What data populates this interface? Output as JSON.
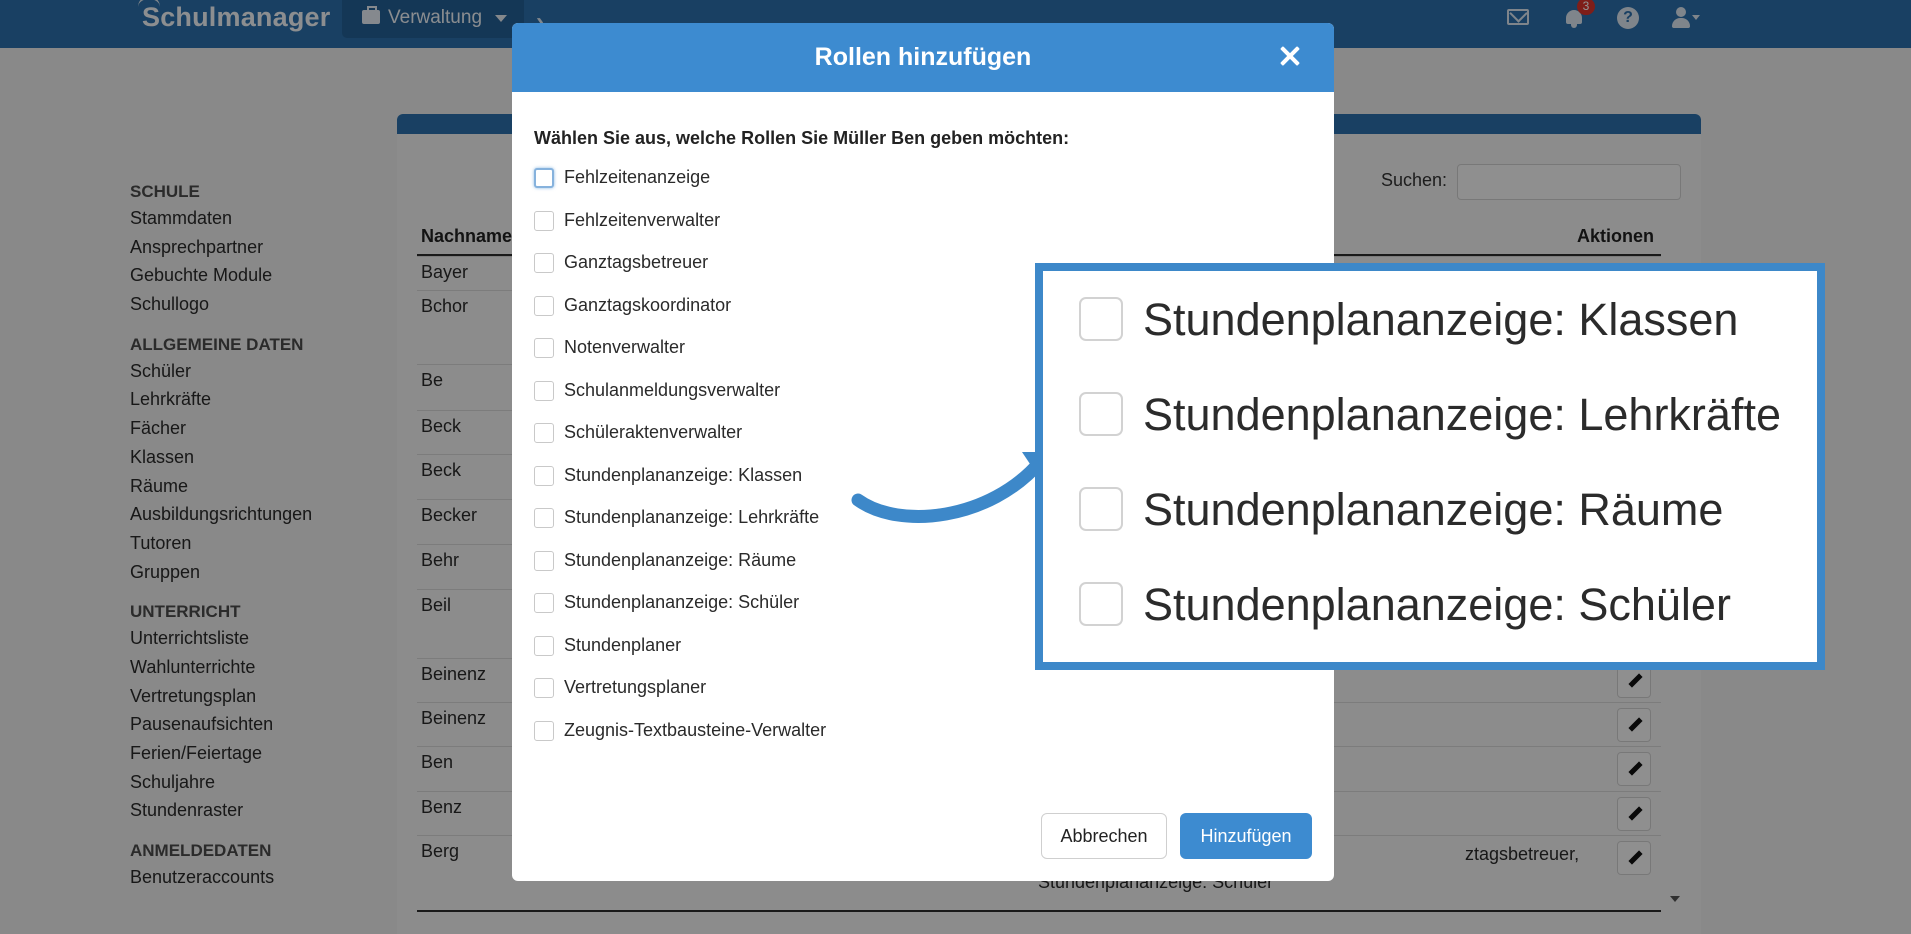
{
  "app": {
    "logo": "Schulmanager",
    "menu_label": "Verwaltung",
    "notification_count": "3",
    "help_glyph": "?"
  },
  "sidebar": {
    "sections": [
      {
        "title": "SCHULE",
        "items": [
          "Stammdaten",
          "Ansprechpartner",
          "Gebuchte Module",
          "Schullogo"
        ]
      },
      {
        "title": "ALLGEMEINE DATEN",
        "items": [
          "Schüler",
          "Lehrkräfte",
          "Fächer",
          "Klassen",
          "Räume",
          "Ausbildungsrichtungen",
          "Tutoren",
          "Gruppen"
        ]
      },
      {
        "title": "UNTERRICHT",
        "items": [
          "Unterrichtsliste",
          "Wahlunterrichte",
          "Vertretungsplan",
          "Pausenaufsichten",
          "Ferien/Feiertage",
          "Schuljahre",
          "Stundenraster"
        ]
      },
      {
        "title": "ANMELDEDATEN",
        "items": [
          "Benutzeraccounts"
        ]
      }
    ]
  },
  "table": {
    "search_label": "Suchen:",
    "header_name": "Nachname",
    "header_actions": "Aktionen",
    "rows": [
      "Bayer",
      "Bchor",
      "Be",
      "Beck",
      "Beck",
      "Becker",
      "Behr",
      "Beil",
      "Beinenz",
      "Beinenz",
      "Ben",
      "Benz",
      "Berg"
    ],
    "berg_roles_line1": "ztagsbetreuer,",
    "berg_roles_line2": "Stundenplananzeige: Schüler"
  },
  "modal": {
    "title": "Rollen hinzufügen",
    "prompt": "Wählen Sie aus, welche Rollen Sie Müller Ben geben möchten:",
    "options": [
      {
        "label": "Fehlzeitenanzeige",
        "checked": false
      },
      {
        "label": "Fehlzeitenverwalter",
        "checked": false
      },
      {
        "label": "Ganztagsbetreuer",
        "checked": false
      },
      {
        "label": "Ganztagskoordinator",
        "checked": false
      },
      {
        "label": "Notenverwalter",
        "checked": false
      },
      {
        "label": "Schulanmeldungsverwalter",
        "checked": false
      },
      {
        "label": "Schüleraktenverwalter",
        "checked": false
      },
      {
        "label": "Stundenplananzeige: Klassen",
        "checked": false
      },
      {
        "label": "Stundenplananzeige: Lehrkräfte",
        "checked": false
      },
      {
        "label": "Stundenplananzeige: Räume",
        "checked": false
      },
      {
        "label": "Stundenplananzeige: Schüler",
        "checked": false
      },
      {
        "label": "Stundenplaner",
        "checked": false
      },
      {
        "label": "Vertretungsplaner",
        "checked": false
      },
      {
        "label": "Zeugnis-Textbausteine-Verwalter",
        "checked": false
      }
    ],
    "cancel_label": "Abbrechen",
    "add_label": "Hinzufügen"
  },
  "callout": {
    "items": [
      "Stundenplananzeige: Klassen",
      "Stundenplananzeige: Lehrkräfte",
      "Stundenplananzeige: Räume",
      "Stundenplananzeige: Schüler"
    ]
  },
  "colors": {
    "topbar": "#2b6fab",
    "modal_header": "#3d8bd0",
    "callout_border": "#3d88c9"
  }
}
